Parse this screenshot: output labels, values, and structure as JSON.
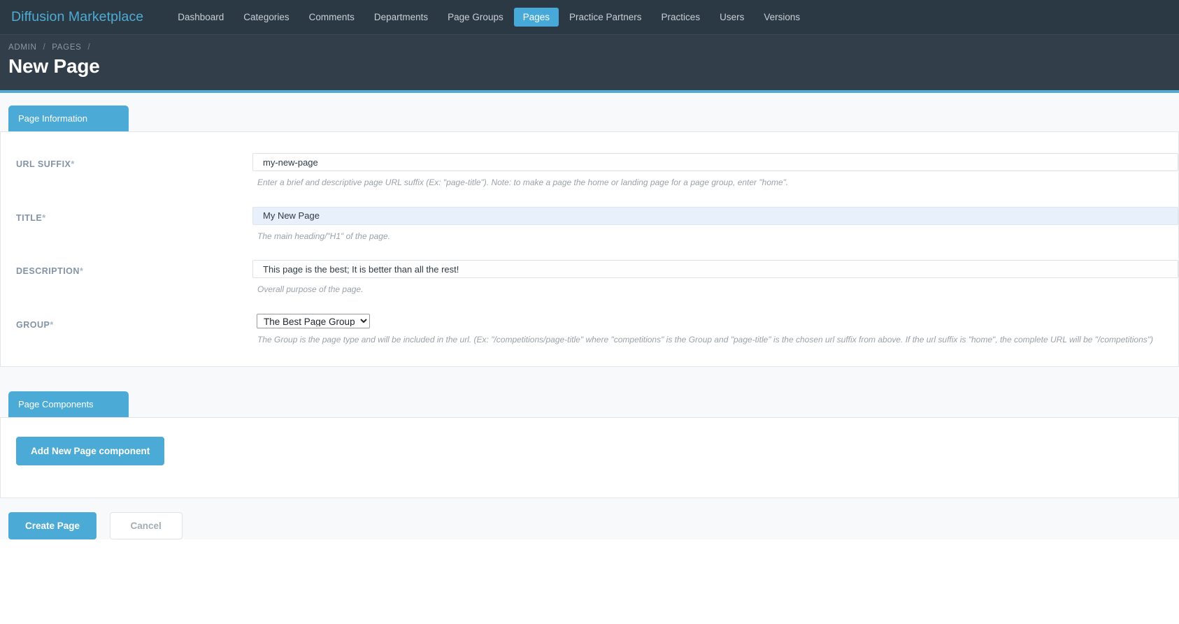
{
  "navbar": {
    "brand": "Diffusion Marketplace",
    "links": [
      {
        "label": "Dashboard",
        "active": false
      },
      {
        "label": "Categories",
        "active": false
      },
      {
        "label": "Comments",
        "active": false
      },
      {
        "label": "Departments",
        "active": false
      },
      {
        "label": "Page Groups",
        "active": false
      },
      {
        "label": "Pages",
        "active": true
      },
      {
        "label": "Practice Partners",
        "active": false
      },
      {
        "label": "Practices",
        "active": false
      },
      {
        "label": "Users",
        "active": false
      },
      {
        "label": "Versions",
        "active": false
      }
    ]
  },
  "header": {
    "breadcrumb": [
      "ADMIN",
      "PAGES"
    ],
    "separator": "/",
    "title": "New Page"
  },
  "page_information": {
    "tab_label": "Page Information",
    "fields": {
      "url_suffix": {
        "label": "URL SUFFIX",
        "required_marker": "*",
        "value": "my-new-page",
        "help": "Enter a brief and descriptive page URL suffix (Ex: \"page-title\"). Note: to make a page the home or landing page for a page group, enter \"home\"."
      },
      "title": {
        "label": "TITLE",
        "required_marker": "*",
        "value": "My New Page",
        "help": "The main heading/\"H1\" of the page."
      },
      "description": {
        "label": "DESCRIPTION",
        "required_marker": "*",
        "value": "This page is the best; It is better than all the rest!",
        "help": "Overall purpose of the page."
      },
      "group": {
        "label": "GROUP",
        "required_marker": "*",
        "selected": "The Best Page Group",
        "options": [
          "The Best Page Group"
        ],
        "help": "The Group is the page type and will be included in the url. (Ex: \"/competitions/page-title\" where \"competitions\" is the Group and \"page-title\" is the chosen url suffix from above. If the url suffix is \"home\", the complete URL will be \"/competitions\")"
      }
    }
  },
  "page_components": {
    "tab_label": "Page Components",
    "add_button": "Add New Page component"
  },
  "actions": {
    "create_label": "Create Page",
    "cancel_label": "Cancel"
  },
  "colors": {
    "brand": "#4fabd4",
    "accent": "#4cabd6",
    "navbar_bg": "#2b3944",
    "header_bg": "#323f4b",
    "label": "#8394a6",
    "autofill": "#e8f0fb"
  }
}
